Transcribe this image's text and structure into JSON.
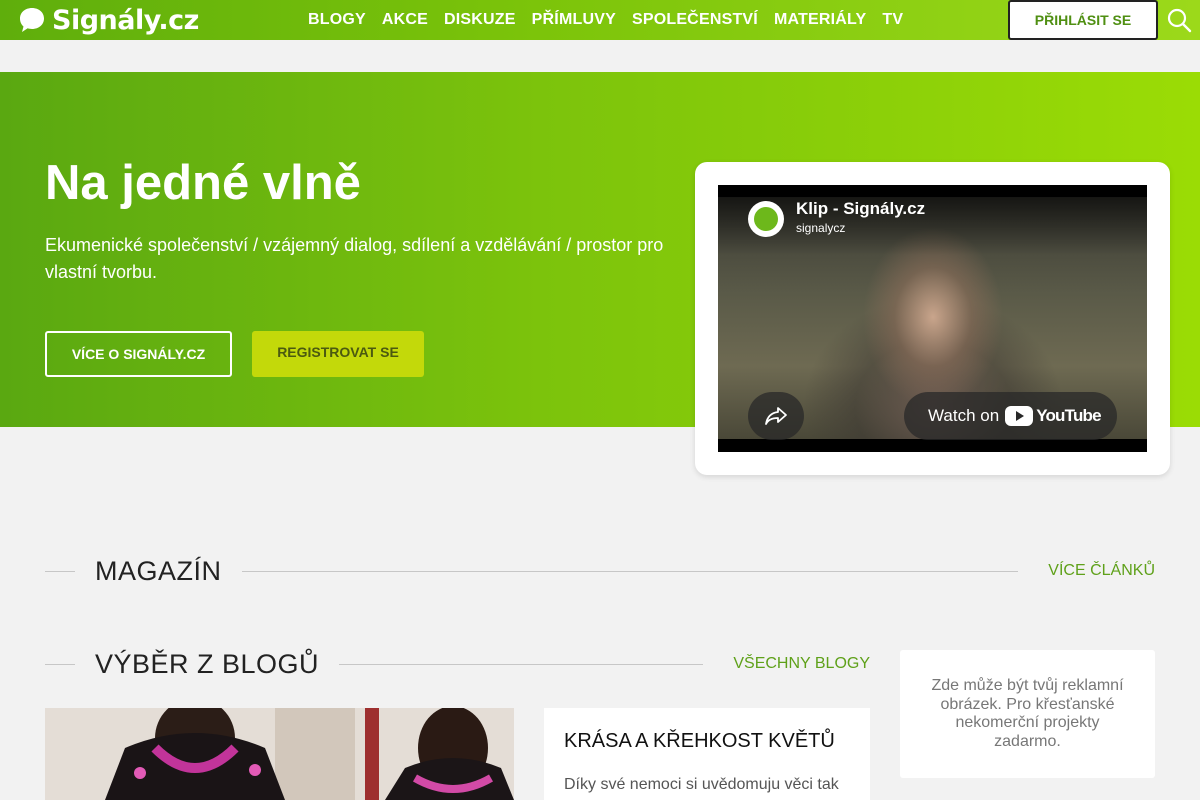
{
  "header": {
    "logo_text": "Signály.cz",
    "nav": [
      "BLOGY",
      "AKCE",
      "DISKUZE",
      "PŘÍMLUVY",
      "SPOLEČENSTVÍ",
      "MATERIÁLY",
      "TV"
    ],
    "login_label": "PŘIHLÁSIT SE",
    "search_icon": "search-icon"
  },
  "hero": {
    "title": "Na jedné vlně",
    "subtitle": "Ekumenické společenství / vzájemný dialog, sdílení a vzdělávání / prostor pro vlastní tvorbu.",
    "more_label": "VÍCE O SIGNÁLY.CZ",
    "register_label": "REGISTROVAT SE"
  },
  "video": {
    "title": "Klip - Signály.cz",
    "channel": "signalycz",
    "watch_on": "Watch on",
    "platform": "YouTube"
  },
  "magazine": {
    "title": "MAGAZÍN",
    "link": "VÍCE ČLÁNKŮ"
  },
  "blogs": {
    "title": "VÝBĚR Z BLOGŮ",
    "link": "VŠECHNY BLOGY",
    "card_title": "KRÁSA A KŘEHKOST KVĚTŮ",
    "card_excerpt": "Díky své nemoci si uvědomuju věci tak"
  },
  "ad": {
    "text": "Zde může být tvůj reklamní obrázek. Pro křesťanské nekomerční projekty zadarmo."
  },
  "colors": {
    "brand_green": "#7cc40a",
    "link_green": "#5fa11a",
    "register_yellow": "#c3d90a"
  }
}
